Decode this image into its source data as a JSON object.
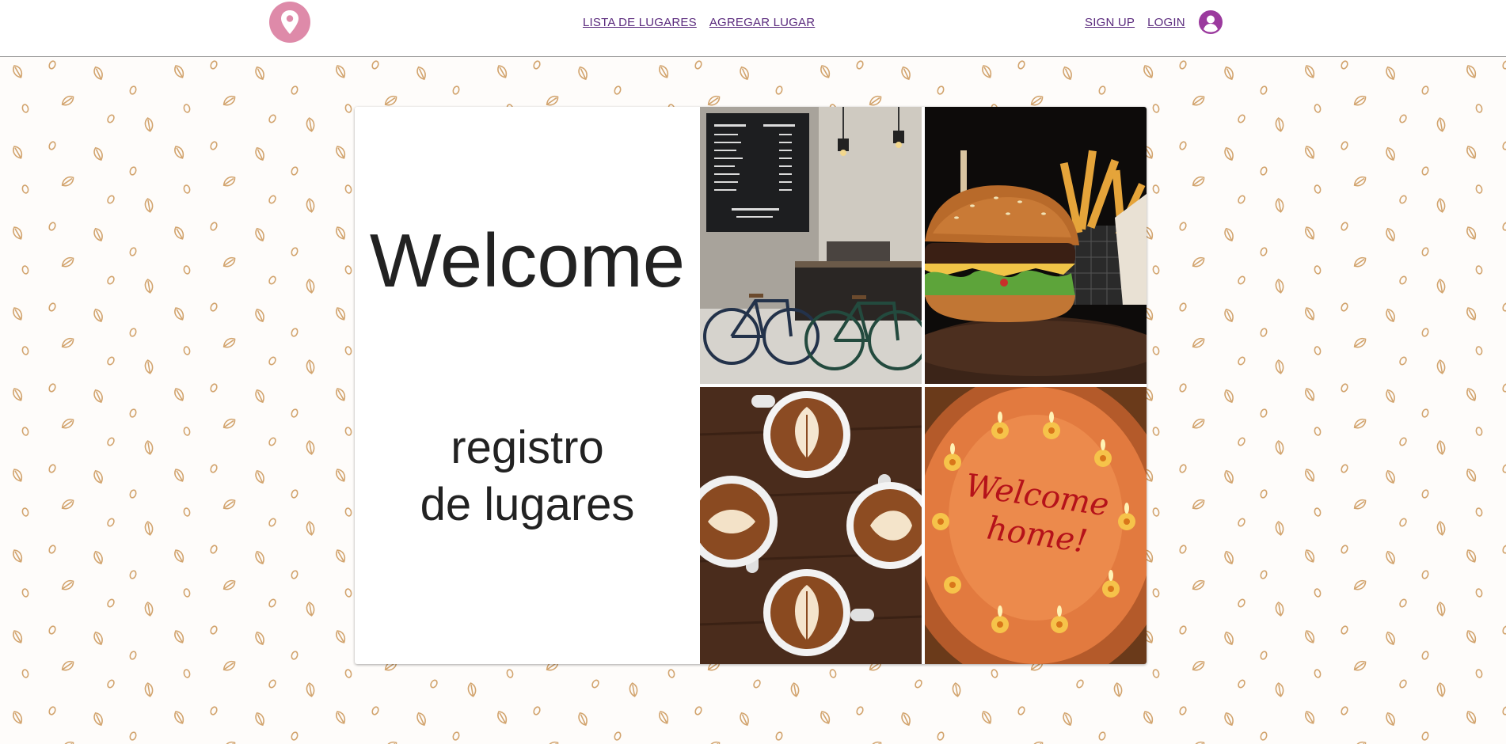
{
  "nav": {
    "logo_icon": "map-pin-icon",
    "links_center": [
      "LISTA DE LUGARES",
      "AGREGAR LUGAR"
    ],
    "links_right": [
      "SIGN UP",
      "LOGIN"
    ],
    "user_icon": "user-avatar-icon"
  },
  "hero": {
    "title": "Welcome",
    "subtitle_line1": "registro",
    "subtitle_line2": "de lugares",
    "cake_text_line1": "Welcome",
    "cake_text_line2": "home!"
  },
  "colors": {
    "logo": "#de8aa9",
    "link": "#5a2a7d",
    "user_icon": "#9b3a9e",
    "pattern_leaf": "#d2a46e"
  }
}
